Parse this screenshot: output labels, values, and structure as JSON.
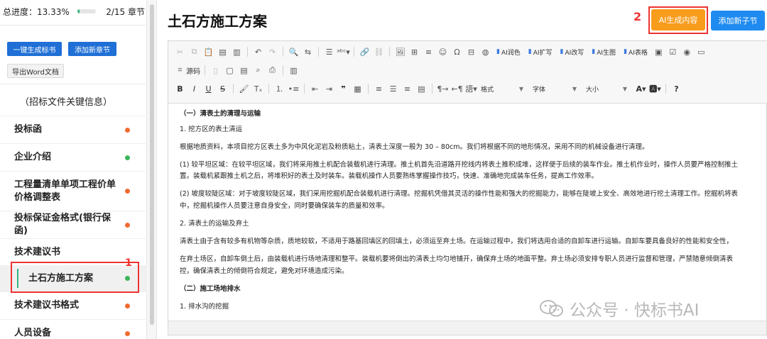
{
  "sidebar": {
    "progress_label": "总进度：13.33%",
    "progress_fraction": 0.1333,
    "chapter_count": "2/15 章节",
    "btn_generate": "一键生成标书",
    "btn_add_chapter": "添加新章节",
    "btn_export": "导出Word文档",
    "items": [
      {
        "label": "（招标文件关键信息）",
        "status": "none"
      },
      {
        "label": "投标函",
        "status": "orange"
      },
      {
        "label": "企业介绍",
        "status": "green"
      },
      {
        "label": "工程量清单单项工程价单价格调整表",
        "status": "orange"
      },
      {
        "label": "投标保证金格式(银行保函)",
        "status": "orange"
      },
      {
        "label": "技术建议书",
        "status": "none"
      },
      {
        "label": "土石方施工方案",
        "status": "green"
      },
      {
        "label": "技术建议书格式",
        "status": "orange"
      },
      {
        "label": "人员设备",
        "status": "orange"
      }
    ]
  },
  "annotations": {
    "one": "1",
    "two": "2"
  },
  "header": {
    "title": "土石方施工方案",
    "btn_ai_generate": "AI生成内容",
    "btn_add_subsection": "添加新子节"
  },
  "toolbar": {
    "ai_polish": "AI润色",
    "ai_expand": "AI扩写",
    "ai_rewrite": "AI改写",
    "ai_image": "AI生图",
    "ai_table": "AI表格",
    "source": "源码",
    "format_select": "格式",
    "font_select": "字体",
    "size_select": "大小"
  },
  "content": {
    "h1": "（一）清表土的清理与运输",
    "p1": "1. 挖方区的表土清运",
    "p2": "根据地质资料，本项目挖方区表土多为中风化泥岩及粉质粘土，清表土深度一般为 30 – 80cm。我们将根据不同的地形情况，采用不同的机械设备进行清理。",
    "p3a": "(1) 较平坦区域：在较平坦区域，我们将采用推土机配合装载机进行清理。推土机首先沿道路开挖线内将表土推积成堆，这样便于后续的装车作业。推土机作业时，操作人员要严格控制推土",
    "p3b": "置。装载机紧跟推土机之后，将堆积好的表土及时装车。装载机操作人员要熟练掌握操作技巧，快速、准确地完成装车任务，提高工作效率。",
    "p4a": "(2) 坡度较陡区域：对于坡度较陡区域，我们采用挖掘机配合装载机进行清理。挖掘机凭借其灵活的操作性能和强大的挖掘能力，能够在陡坡上安全、高效地进行挖土清理工作。挖掘机将表",
    "p4b": "中，挖掘机操作人员要注意自身安全，同时要确保装车的质量和效率。",
    "p5": "2. 清表土的运输及弃土",
    "p6a": "清表土由于含有较多有机物等杂质，质地较软，不适用于路基回填区的回填土，必须运至弃土场。在运输过程中，我们将选用合适的自卸车进行运输。自卸车要具备良好的性能和安全性，",
    "p7a": "在弃土场区，自卸车倒土后，由装载机进行场地清理和整平。装载机要将倒出的清表土均匀地铺开，确保弃土场的地面平整。弃土场必须安排专职人员进行监督和管理，严禁随意倾倒清表",
    "p7b": "控，确保清表土的倾倒符合规定，避免对环境造成污染。",
    "h2": "（二）施工场地排水",
    "p8": "1. 排水沟的挖掘"
  },
  "watermark": "公众号 · 快标书AI"
}
